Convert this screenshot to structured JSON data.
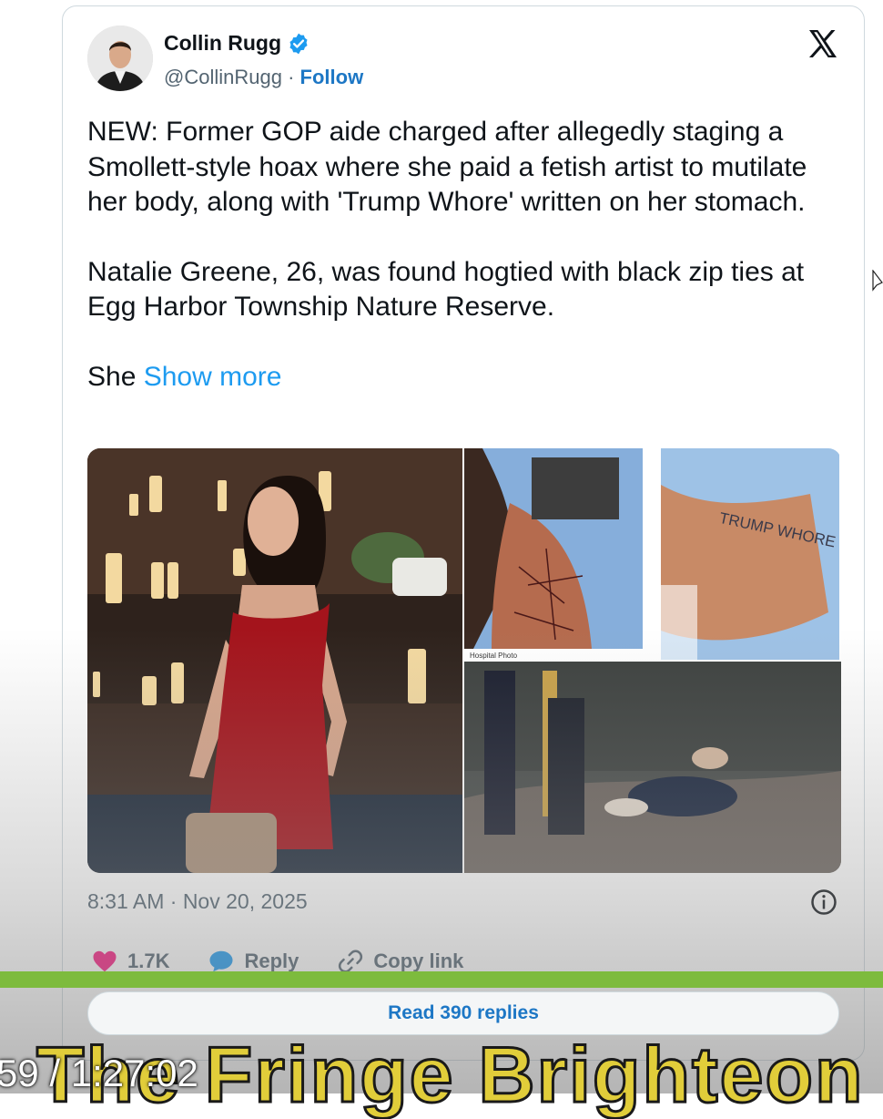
{
  "tweet": {
    "author_name": "Collin Rugg",
    "handle": "@CollinRugg",
    "separator": "·",
    "follow_label": "Follow",
    "paragraphs": [
      "NEW: Former GOP aide charged after allegedly staging a Smollett-style hoax where she paid a fetish artist to mutilate her body, along with 'Trump Whore' written on her stomach.",
      "Natalie Greene, 26, was found hogtied with black zip ties at Egg Harbor Township Nature Reserve."
    ],
    "truncated_text": "She",
    "show_more_label": "Show more",
    "media": {
      "photo_caption": "Hospital Photo",
      "stomach_text": "TRUMP WHORE"
    },
    "timestamp": "8:31 AM · Nov 20, 2025",
    "actions": {
      "like_count": "1.7K",
      "reply_label": "Reply",
      "copy_link_label": "Copy link"
    },
    "read_replies_label": "Read 390 replies"
  },
  "video_overlay": {
    "time_code": "59 / 1:27:02",
    "channel_banner": "The Fringe Brighteon"
  },
  "colors": {
    "brand_blue": "#1d9bf0",
    "follow_blue": "#1d77c5",
    "like_pink": "#f91880",
    "accent_green": "#7dbb3d",
    "banner_yellow": "#e1cd3a"
  },
  "icons": [
    "verified-badge-icon",
    "x-logo-icon",
    "info-icon",
    "heart-icon",
    "reply-icon",
    "link-icon",
    "cursor-icon"
  ]
}
